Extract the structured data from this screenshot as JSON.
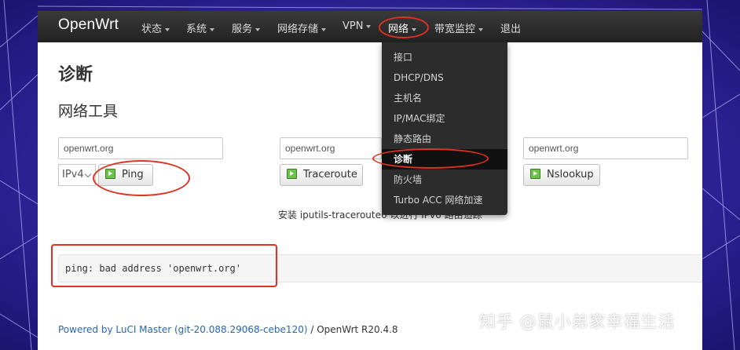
{
  "brand": "OpenWrt",
  "nav": [
    {
      "label": "状态"
    },
    {
      "label": "系统"
    },
    {
      "label": "服务"
    },
    {
      "label": "网络存储"
    },
    {
      "label": "VPN"
    },
    {
      "label": "网络"
    },
    {
      "label": "带宽监控"
    },
    {
      "label": "退出"
    }
  ],
  "network_menu": [
    {
      "label": "接口"
    },
    {
      "label": "DHCP/DNS"
    },
    {
      "label": "主机名"
    },
    {
      "label": "IP/MAC绑定"
    },
    {
      "label": "静态路由"
    },
    {
      "label": "诊断",
      "active": true
    },
    {
      "label": "防火墙"
    },
    {
      "label": "Turbo ACC 网络加速"
    }
  ],
  "page_title": "诊断",
  "section_title": "网络工具",
  "tools": {
    "ping": {
      "host": "openwrt.org",
      "protocol": "IPv4",
      "button": "Ping"
    },
    "traceroute": {
      "host": "openwrt.org",
      "button": "Traceroute"
    },
    "nslookup": {
      "host": "openwrt.org",
      "button": "Nslookup"
    }
  },
  "hint": "安装 iputils-traceroute6 以进行 IPv6 路由追踪",
  "output": "ping: bad address 'openwrt.org'",
  "footer": {
    "link": "Powered by LuCI Master (git-20.088.29068-cebe120)",
    "version": " / OpenWrt R20.4.8"
  },
  "watermark": "知乎 @鼠小弟家幸福生活",
  "colors": {
    "navbar": "#2a2a2a",
    "dropdown": "#2c2c2c",
    "annotation_red": "#e03020",
    "link": "#2566b5",
    "apply_green": "#6cc34a"
  }
}
